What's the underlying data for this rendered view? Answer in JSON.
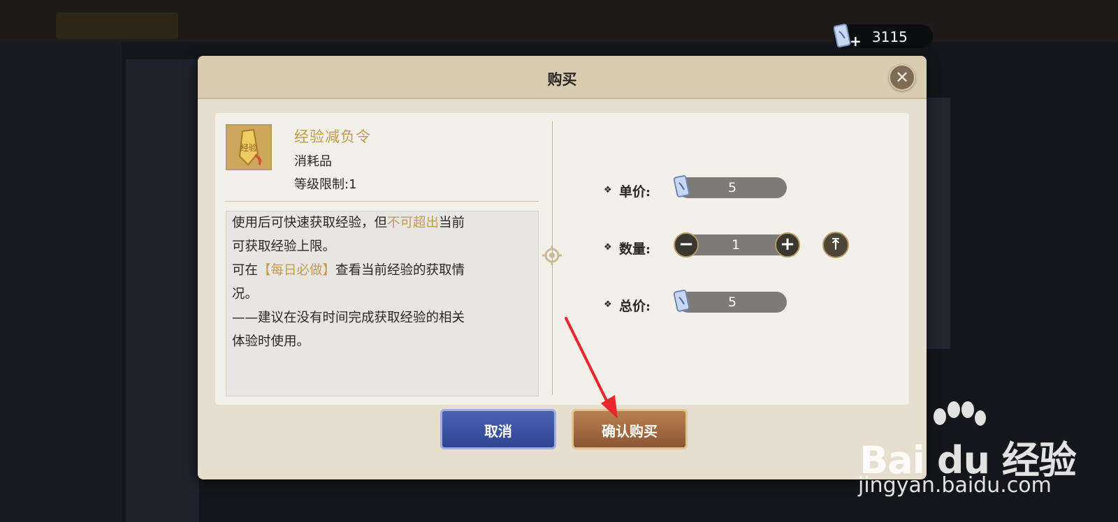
{
  "currency": {
    "amount": "3115",
    "icon": "ticket-icon"
  },
  "dialog": {
    "title": "购买",
    "item": {
      "name": "经验减负令",
      "type": "消耗品",
      "level_limit": "等级限制:1",
      "icon_text": "经验"
    },
    "description": {
      "line1_a": "使用后可快速获取经验，但",
      "line1_hl": "不可超出",
      "line1_b": "当前",
      "line2": "可获取经验上限。",
      "line3_a": "可在",
      "line3_hl": "【每日必做】",
      "line3_b": "查看当前经验的获取情",
      "line4": "况。",
      "line5": "——建议在没有时间完成获取经验的相关",
      "line6": "体验时使用。"
    },
    "unit_price": {
      "label": "单价:",
      "value": "5"
    },
    "quantity": {
      "label": "数量:",
      "value": "1"
    },
    "total_price": {
      "label": "总价:",
      "value": "5"
    },
    "cancel_label": "取消",
    "confirm_label": "确认购买"
  },
  "watermark": {
    "logo": "Bai du 经验",
    "url": "jingyan.baidu.com"
  },
  "colors": {
    "accent_gold": "#c49b4d",
    "cancel_blue": "#3a4f9e",
    "confirm_bronze": "#a06a40",
    "arrow_red": "#e8262b"
  }
}
